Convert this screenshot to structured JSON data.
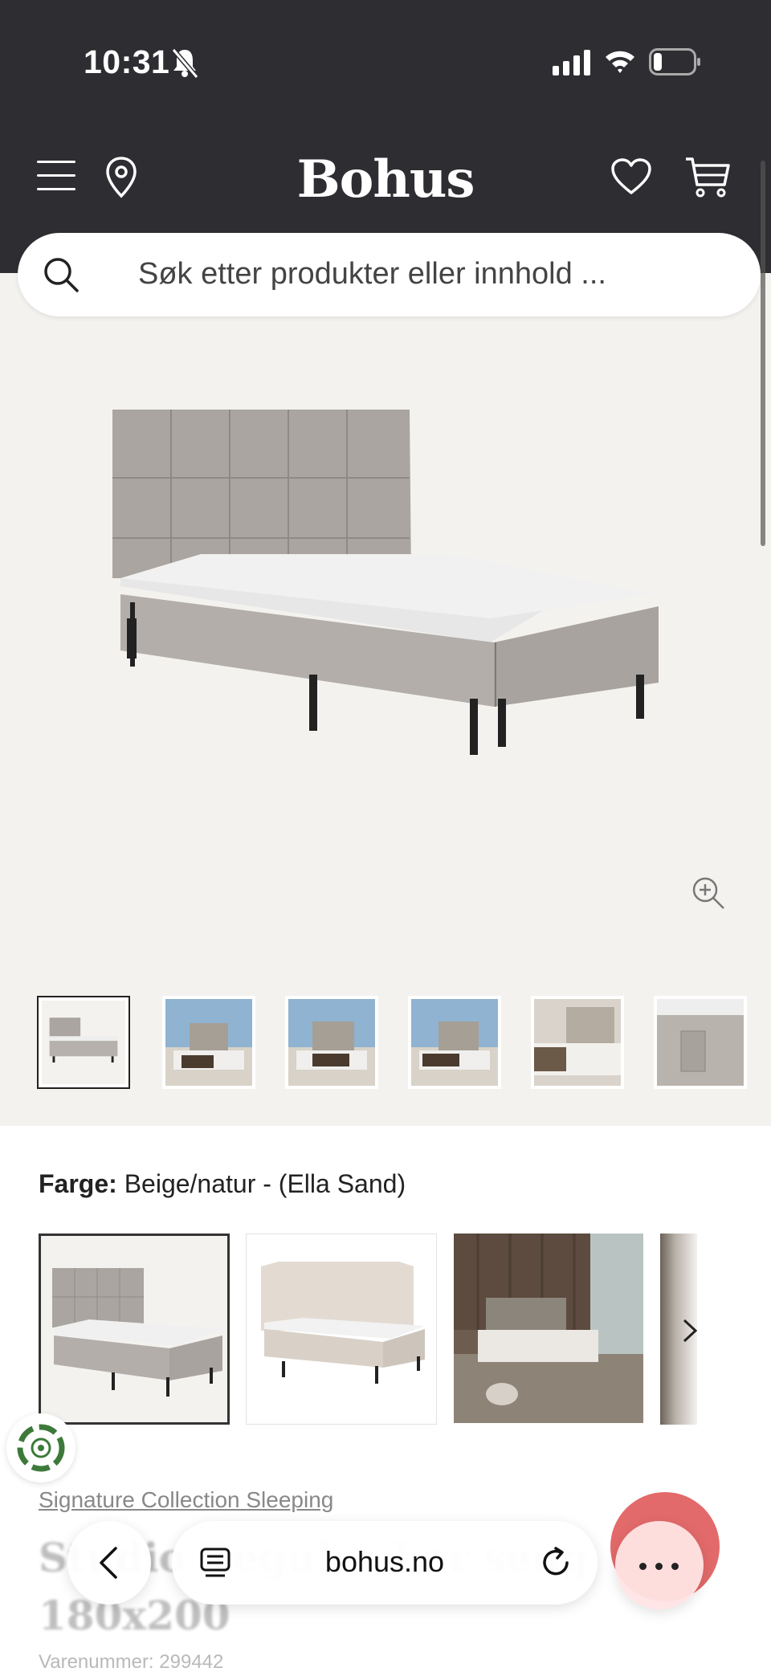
{
  "status_bar": {
    "time": "10:31"
  },
  "header": {
    "logo": "Bohus"
  },
  "search": {
    "placeholder": "Søk etter produkter eller innhold ..."
  },
  "thumbnails": [
    "bed-front",
    "bedroom-sea-1",
    "bedroom-sea-2",
    "bedroom-sea-3",
    "bedroom-interior",
    "bed-pocket-detail"
  ],
  "color_picker": {
    "label": "Farge:",
    "value": "Beige/natur - (Ella Sand)",
    "swatches": [
      "Ella Sand square headboard",
      "Light beige winged headboard",
      "Dark bedroom scene"
    ]
  },
  "product": {
    "collection": "Signature Collection Sleeping",
    "title": "Studio Reguler-bar seng 180x200",
    "sku": "Varenummer: 299442"
  },
  "browser": {
    "url": "bohus.no"
  },
  "colors": {
    "header_bg": "#2e2d31",
    "page_bg": "#f4f2ef",
    "fab": "#e05a5a"
  }
}
